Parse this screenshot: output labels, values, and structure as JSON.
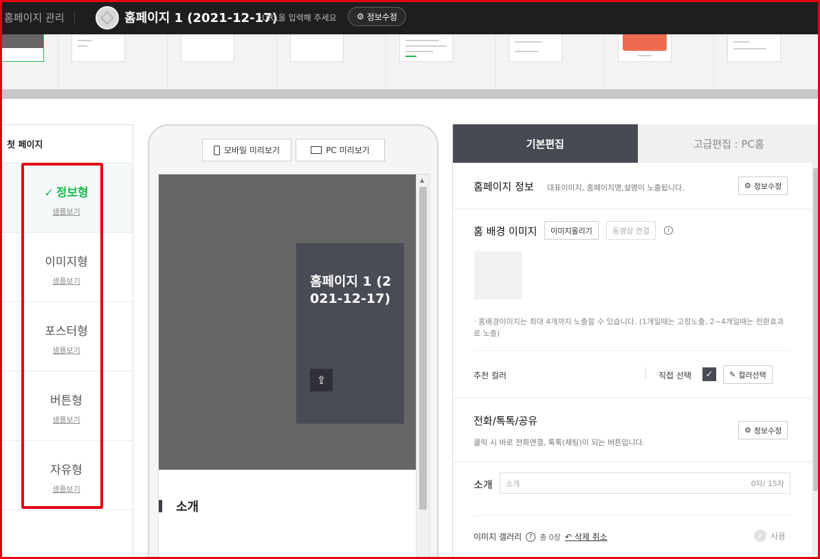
{
  "topbar": {
    "manager_label": "홈페이지 관리",
    "site_title": "홈페이지 1 (2021-12-17)",
    "url_hint": "URL을 입력해 주세요",
    "info_edit": "정보수정"
  },
  "left_panel": {
    "heading": "첫 페이지",
    "types": [
      {
        "label": "정보형",
        "sample": "샘플보기"
      },
      {
        "label": "이미지형",
        "sample": "샘플보기"
      },
      {
        "label": "포스터형",
        "sample": "샘플보기"
      },
      {
        "label": "버튼형",
        "sample": "샘플보기"
      },
      {
        "label": "자유형",
        "sample": "샘플보기"
      }
    ],
    "selected_index": 0,
    "highlight_color": "#e60012",
    "accent_color": "#1dbb4e"
  },
  "preview": {
    "mobile_button": "모바일 미리보기",
    "pc_button": "PC 미리보기",
    "card_title": "홈페이지 1 (2021-12-17)",
    "intro_heading": "소개"
  },
  "editor": {
    "tab_basic": "기본편집",
    "tab_advanced": "고급편집 : PC홈",
    "homepage_info": {
      "title": "홈페이지 정보",
      "desc": "대표이미지, 홈페이지명,설명이 노출됩니다.",
      "button": "정보수정"
    },
    "bg_image": {
      "title": "홈 배경 이미지",
      "upload_button": "이미지올리기",
      "video_button": "동영상 연결",
      "note": "홈배경이미지는 최대 4개까지 노출할 수 있습니다. (1개일때는 고정노출, 2~4개일때는 전환효과로 노출)",
      "recommend_color": "추천 컬러",
      "direct_select": "직접 선택",
      "color_button": "컬러선택"
    },
    "contact": {
      "title": "전화/톡톡/공유",
      "desc": "클릭 시 바로 전화연결, 톡톡(채팅)이 되는 버튼입니다.",
      "button": "정보수정"
    },
    "intro": {
      "label": "소개",
      "placeholder": "소개",
      "counter": "0자/ 15자"
    },
    "gallery": {
      "label": "이미지 갤러리",
      "count": "총 0장",
      "undo": "삭제 취소",
      "use": "사용"
    }
  }
}
